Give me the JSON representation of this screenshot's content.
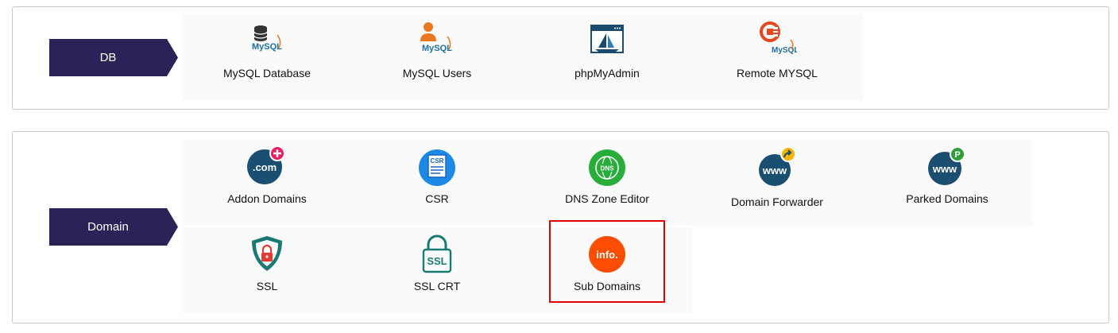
{
  "sections": [
    {
      "label": "DB",
      "items": [
        {
          "label": "MySQL Database",
          "icon": "mysql-database-icon"
        },
        {
          "label": "MySQL Users",
          "icon": "mysql-users-icon"
        },
        {
          "label": "phpMyAdmin",
          "icon": "phpmyadmin-icon"
        },
        {
          "label": "Remote MYSQL",
          "icon": "remote-mysql-icon"
        }
      ]
    },
    {
      "label": "Domain",
      "items": [
        {
          "label": "Addon Domains",
          "icon": "addon-domains-icon",
          "icon_text": ".com"
        },
        {
          "label": "CSR",
          "icon": "csr-icon",
          "icon_text": "CSR"
        },
        {
          "label": "DNS Zone Editor",
          "icon": "dns-zone-editor-icon",
          "icon_text": "DNS"
        },
        {
          "label": "Domain Forwarder",
          "icon": "domain-forwarder-icon",
          "icon_text": "www"
        },
        {
          "label": "Parked Domains",
          "icon": "parked-domains-icon",
          "icon_text": "www"
        },
        {
          "label": "SSL",
          "icon": "ssl-shield-icon"
        },
        {
          "label": "SSL CRT",
          "icon": "ssl-crt-icon",
          "icon_text": "SSL"
        },
        {
          "label": "Sub Domains",
          "icon": "sub-domains-icon",
          "icon_text": "info.",
          "selected": true
        }
      ]
    }
  ],
  "icon_labels": {
    "mysql": "MySQL",
    "parked_badge": "P"
  },
  "colors": {
    "section_label_bg": "#2b2358",
    "selection_border": "#e00000",
    "mysql_orange": "#e87722",
    "domain_blue": "#1b4f72",
    "csr_blue": "#1e88e5",
    "dns_green": "#27ae3a",
    "ssl_teal": "#1a7a73",
    "info_orange": "#ff4d00",
    "badge_pink": "#e91e63",
    "badge_yellow": "#f4b400",
    "badge_green": "#2e9e3a"
  }
}
